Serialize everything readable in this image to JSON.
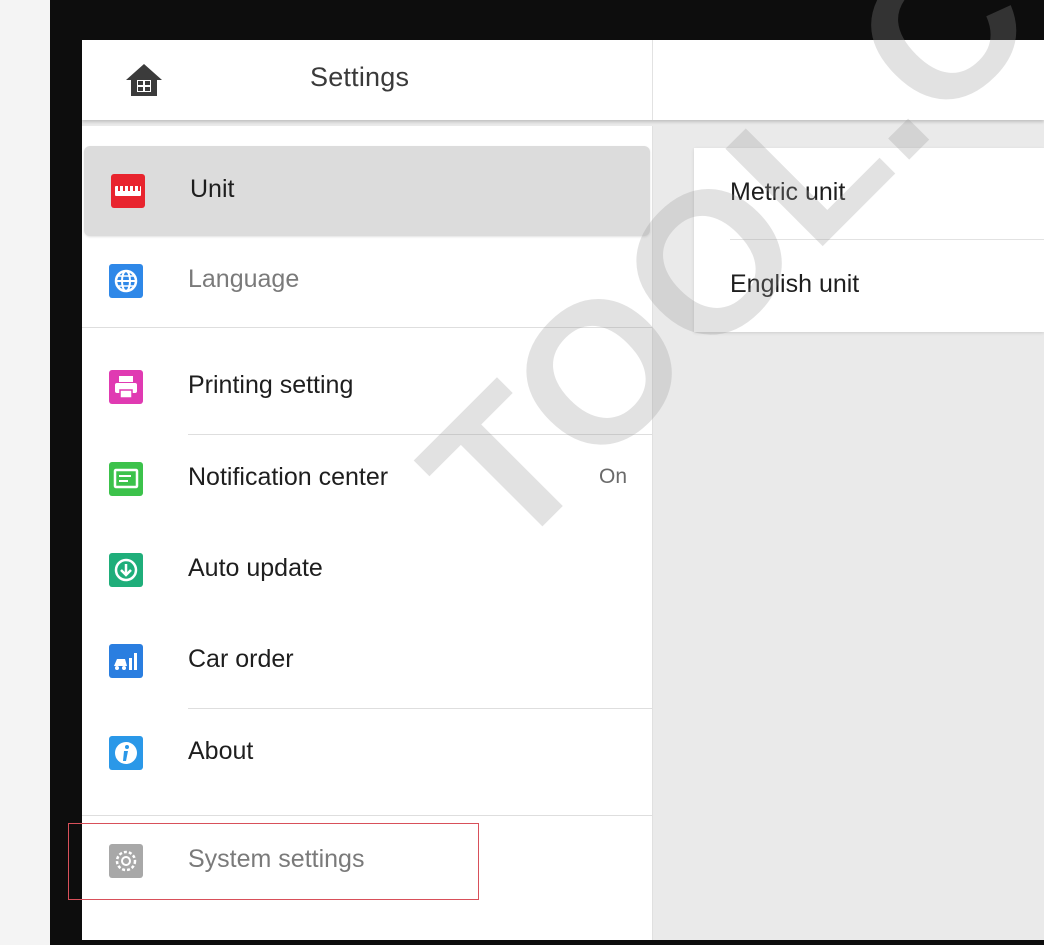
{
  "header": {
    "title": "Settings",
    "home_icon": "home-icon"
  },
  "sidebar": {
    "items": [
      {
        "label": "Unit",
        "icon": "ruler-icon",
        "icon_color": "#e8242e",
        "selected": true
      },
      {
        "label": "Language",
        "icon": "globe-icon",
        "icon_color": "#2f88e8",
        "muted": true
      },
      {
        "label": "Printing setting",
        "icon": "printer-icon",
        "icon_color": "#e03ab2"
      },
      {
        "label": "Notification center",
        "icon": "message-icon",
        "icon_color": "#3cc24b",
        "value": "On"
      },
      {
        "label": "Auto update",
        "icon": "download-icon",
        "icon_color": "#1fae7a"
      },
      {
        "label": "Car order",
        "icon": "car-chart-icon",
        "icon_color": "#2a7ee0"
      },
      {
        "label": "About",
        "icon": "info-icon",
        "icon_color": "#2a98e8"
      },
      {
        "label": "System settings",
        "icon": "gear-icon",
        "icon_color": "#a8a8a8",
        "muted": true
      }
    ]
  },
  "detail": {
    "options": [
      {
        "label": "Metric unit"
      },
      {
        "label": "English unit"
      }
    ]
  },
  "watermark": "TOOL.CO.U",
  "colors": {
    "highlight_border": "#d8505a",
    "selected_bg": "#dcdcdc"
  }
}
